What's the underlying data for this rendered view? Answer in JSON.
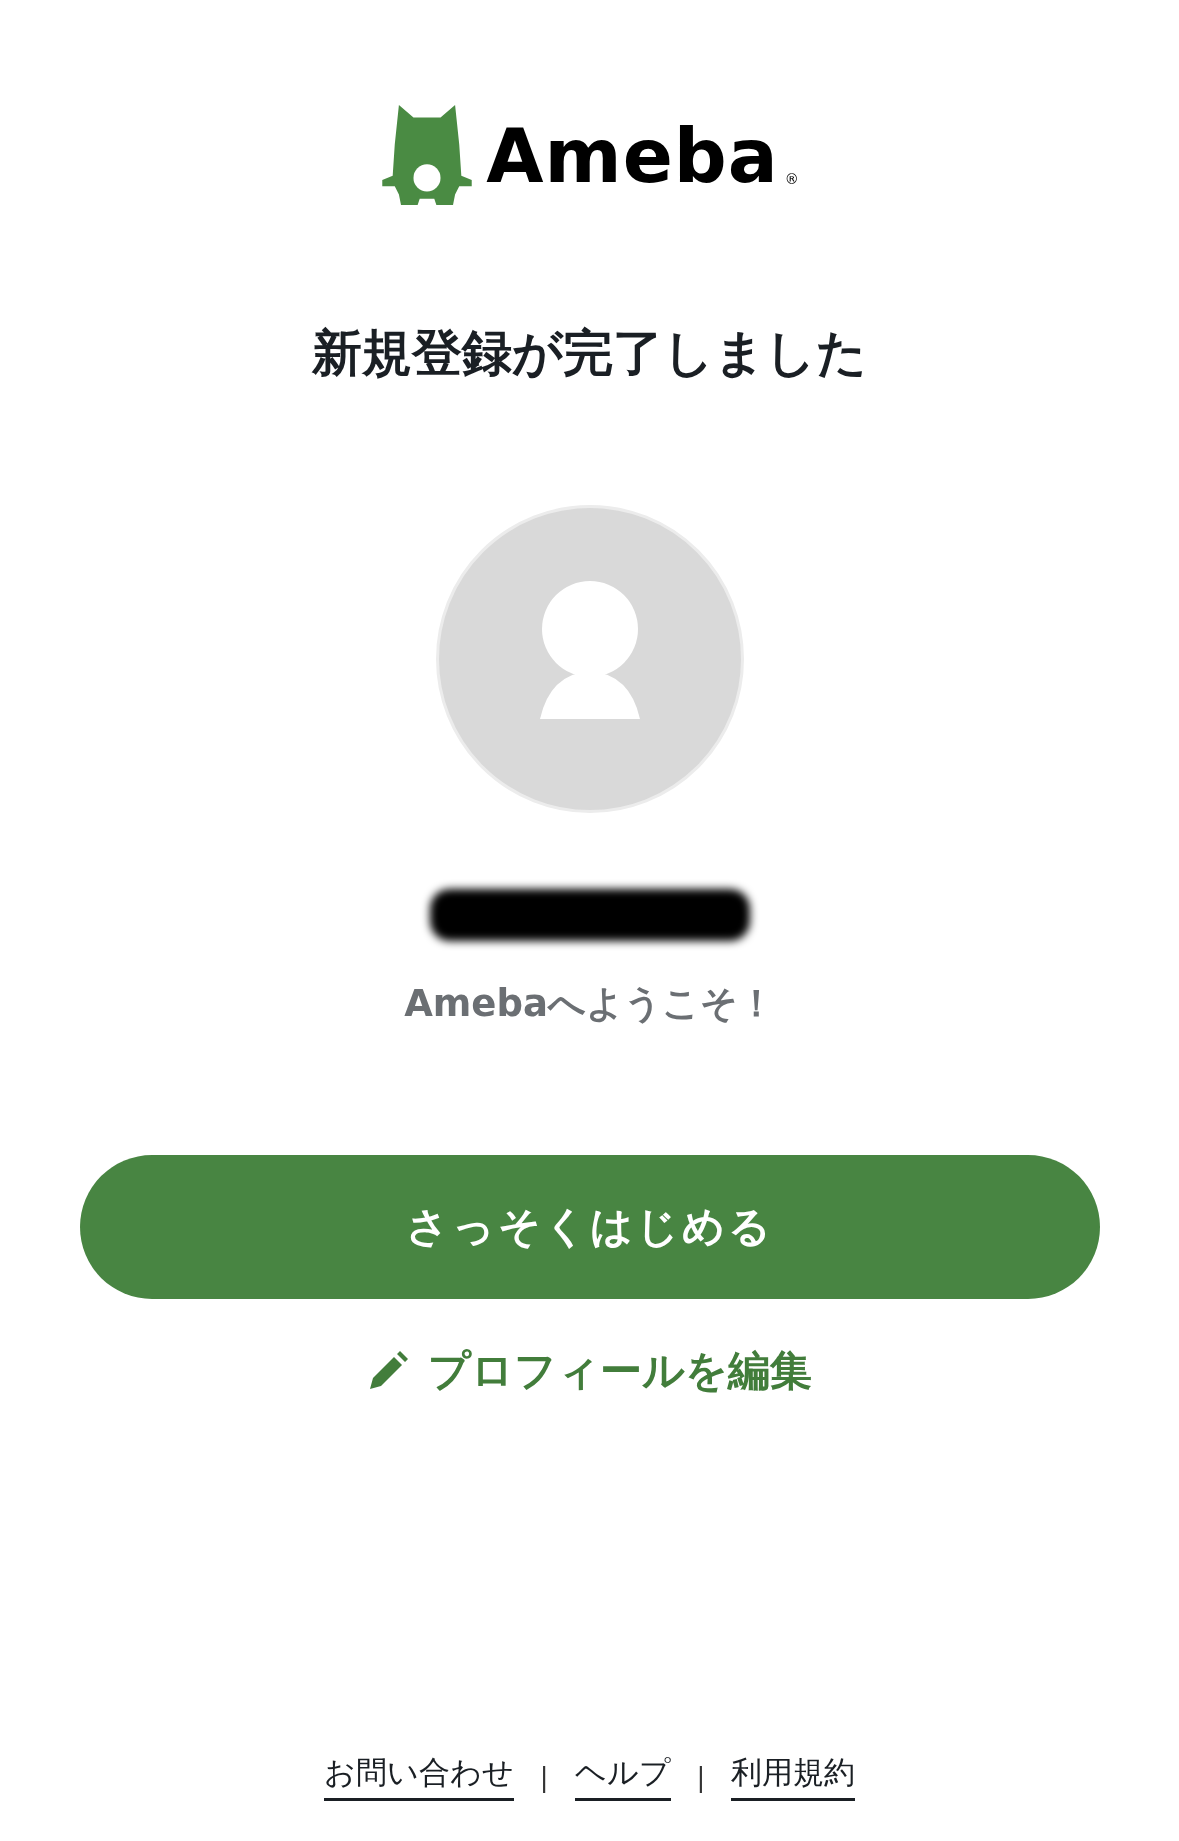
{
  "logo": {
    "wordmark": "Ameba",
    "registered": "®"
  },
  "title": "新規登録が完了しました",
  "profile": {
    "avatar": {
      "kind": "default"
    },
    "name_redacted": true,
    "welcome": "Amebaへようこそ！"
  },
  "primary_button": {
    "label": "さっそくはじめる"
  },
  "edit_link": {
    "label": "プロフィールを編集"
  },
  "footer": [
    {
      "kind": "link",
      "text": "お問い合わせ"
    },
    {
      "kind": "separator",
      "text": "|"
    },
    {
      "kind": "link",
      "text": "ヘルプ"
    },
    {
      "kind": "separator",
      "text": "|"
    },
    {
      "kind": "link",
      "text": "利用規約"
    }
  ]
}
